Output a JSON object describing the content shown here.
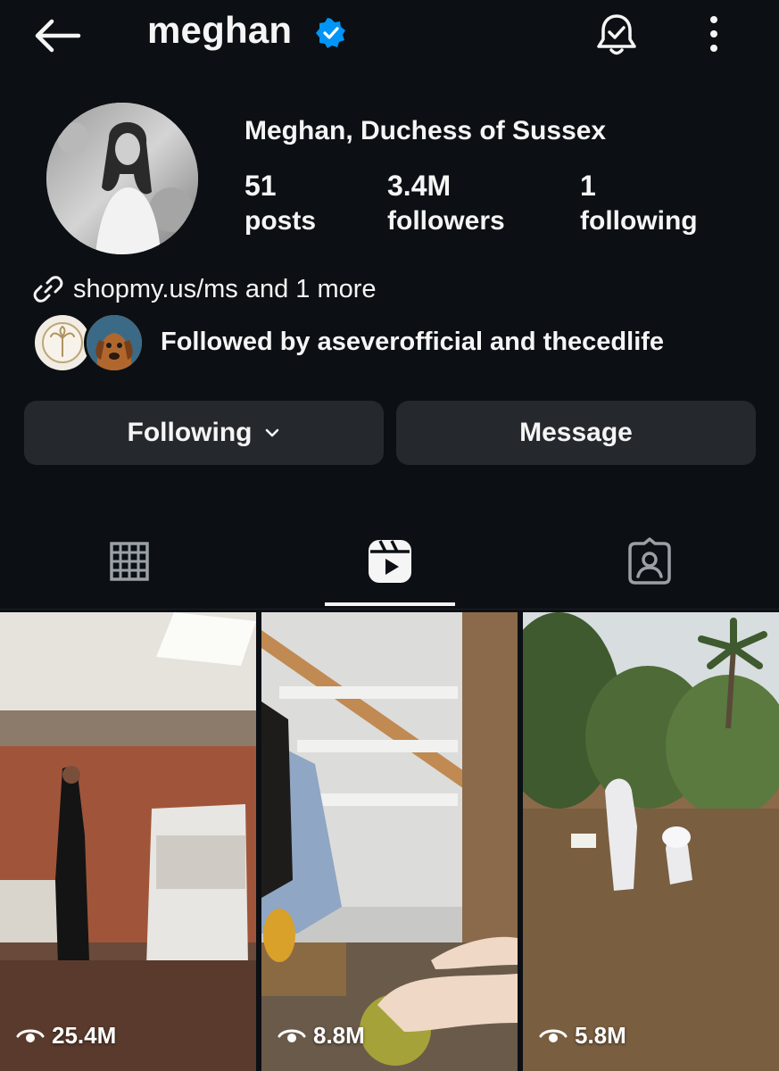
{
  "header": {
    "username": "meghan"
  },
  "profile": {
    "full_name": "Meghan, Duchess of Sussex",
    "stats": [
      {
        "value": "51",
        "label": "posts"
      },
      {
        "value": "3.4M",
        "label": "followers"
      },
      {
        "value": "1",
        "label": "following"
      }
    ],
    "link_text": "shopmy.us/ms and 1 more",
    "followed_by": "Followed by aseverofficial and thecedlife"
  },
  "actions": {
    "following_label": "Following",
    "message_label": "Message"
  },
  "tabs": [
    "grid-icon",
    "reels-icon",
    "tagged-icon"
  ],
  "active_tab": "reels",
  "reels": [
    {
      "views": "25.4M"
    },
    {
      "views": "8.8M"
    },
    {
      "views": "5.8M"
    }
  ],
  "colors": {
    "background": "#0c1014",
    "button": "#25292e",
    "verified": "#0095f6",
    "text": "#f5f5f5"
  }
}
